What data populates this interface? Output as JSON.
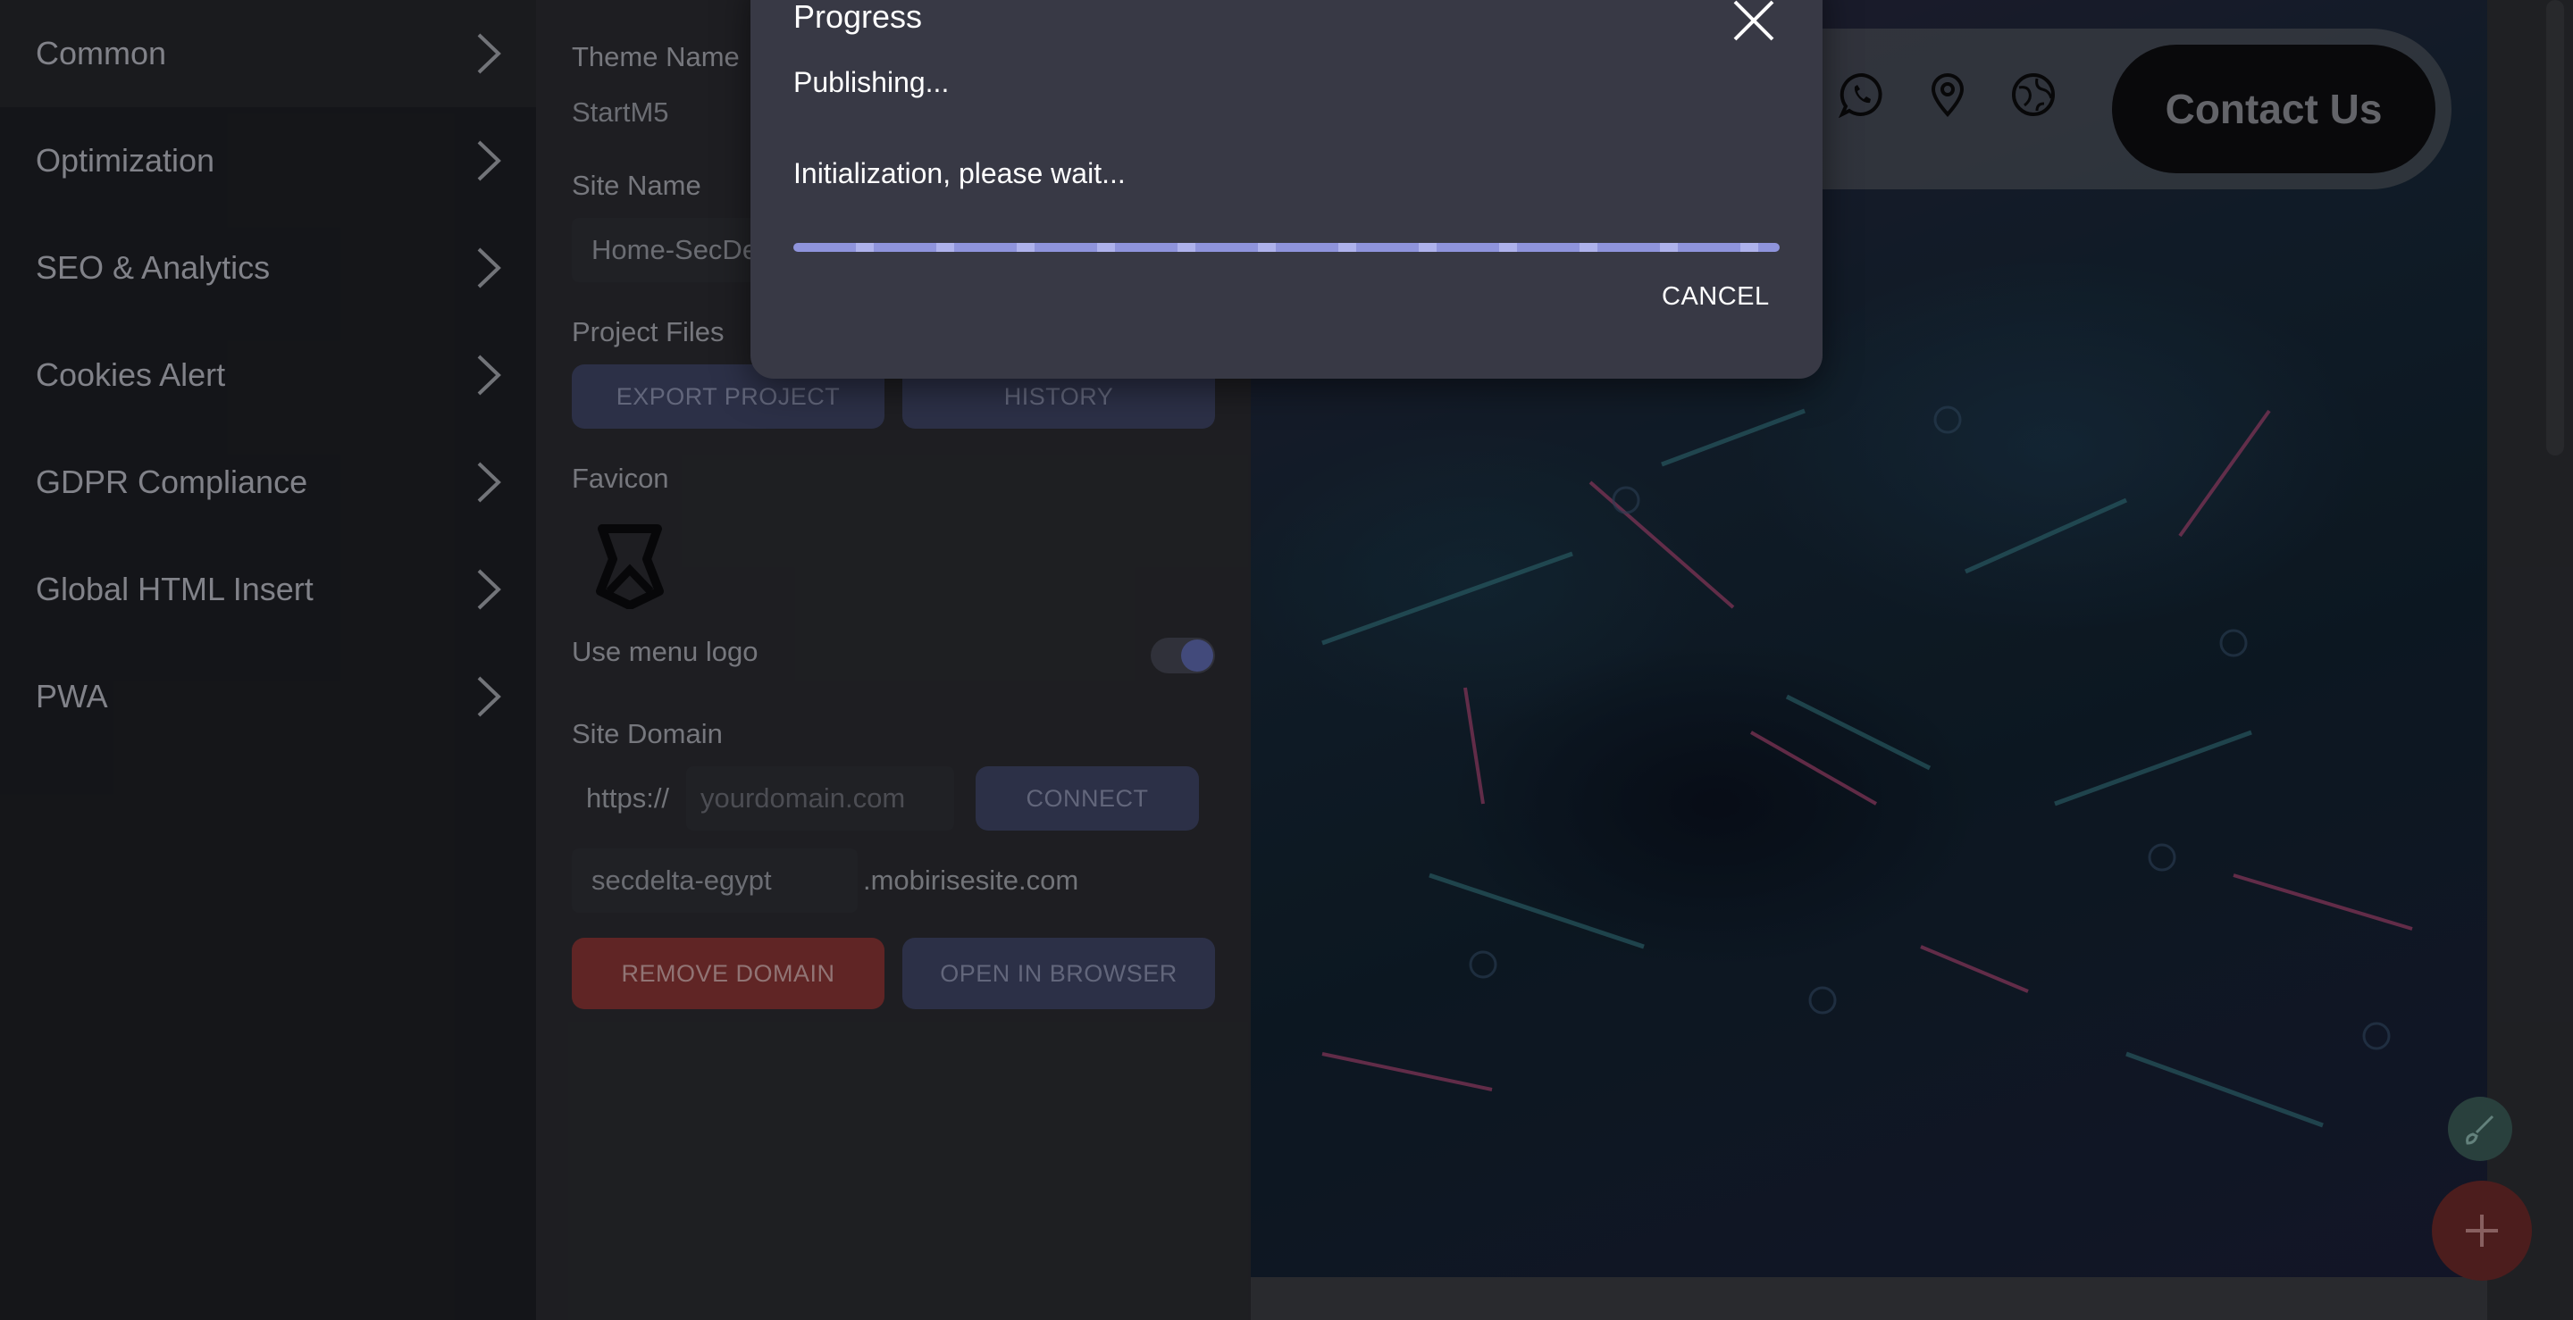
{
  "sidebar": {
    "items": [
      {
        "label": "Common"
      },
      {
        "label": "Optimization"
      },
      {
        "label": "SEO & Analytics"
      },
      {
        "label": "Cookies Alert"
      },
      {
        "label": "GDPR Compliance"
      },
      {
        "label": "Global HTML Insert"
      },
      {
        "label": "PWA"
      }
    ]
  },
  "settings": {
    "theme_name_label": "Theme Name",
    "theme_name_value": "StartM5",
    "site_name_label": "Site Name",
    "site_name_value": "Home-SecDe",
    "project_files_label": "Project Files",
    "export_button": "EXPORT PROJECT",
    "history_button": "HISTORY",
    "favicon_label": "Favicon",
    "use_menu_logo_label": "Use menu logo",
    "use_menu_logo_on": true,
    "site_domain_label": "Site Domain",
    "domain_prefix": "https://",
    "domain_placeholder": "yourdomain.com",
    "connect_button": "CONNECT",
    "subdomain_value": "secdelta-egypt",
    "subdomain_suffix": ".mobirisesite.com",
    "remove_domain_button": "REMOVE DOMAIN",
    "open_browser_button": "OPEN IN BROWSER"
  },
  "preview": {
    "contact_button": "Contact Us",
    "nav_icons": [
      "whatsapp-icon",
      "map-pin-icon",
      "globe-icon"
    ]
  },
  "dialog": {
    "title": "Progress",
    "status": "Publishing...",
    "message": "Initialization, please wait...",
    "cancel_button": "CANCEL",
    "progress_indeterminate": true
  },
  "colors": {
    "accent": "#5f6ab0",
    "danger": "#8a3636",
    "dialog_bg": "#383945",
    "progress": "#8b90d8"
  }
}
